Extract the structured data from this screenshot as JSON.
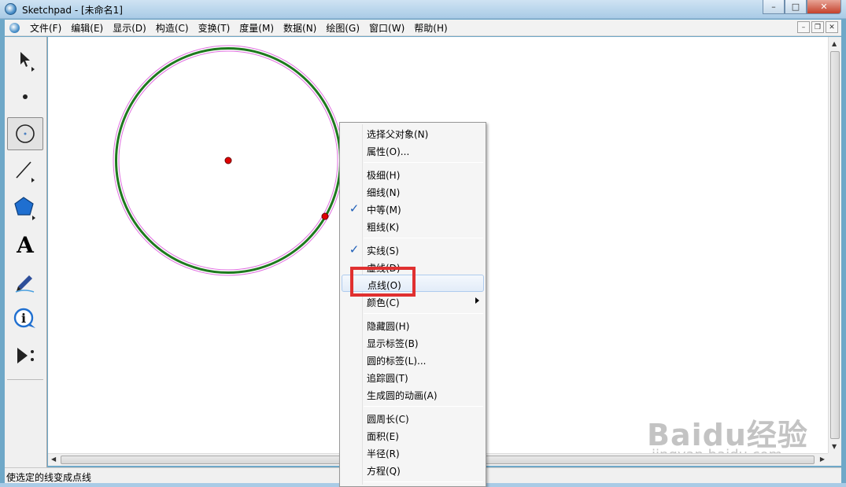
{
  "window": {
    "title": "Sketchpad  - [未命名1]"
  },
  "window_controls": {
    "minimize": "–",
    "maximize": "□",
    "close": "✕"
  },
  "mdi_controls": {
    "minimize": "–",
    "restore": "❐",
    "close": "✕"
  },
  "menubar": {
    "items": [
      "文件(F)",
      "编辑(E)",
      "显示(D)",
      "构造(C)",
      "变换(T)",
      "度量(M)",
      "数据(N)",
      "绘图(G)",
      "窗口(W)",
      "帮助(H)"
    ]
  },
  "toolbox": {
    "tools": [
      {
        "name": "arrow-tool",
        "icon": "arrow-icon"
      },
      {
        "name": "point-tool",
        "icon": "point-icon"
      },
      {
        "name": "compass-tool",
        "icon": "compass-icon",
        "active": true
      },
      {
        "name": "straightedge-tool",
        "icon": "line-icon"
      },
      {
        "name": "polygon-tool",
        "icon": "polygon-icon"
      },
      {
        "name": "text-tool",
        "icon": "text-icon",
        "glyph": "A"
      },
      {
        "name": "marker-tool",
        "icon": "marker-icon"
      },
      {
        "name": "information-tool",
        "icon": "info-icon"
      },
      {
        "name": "custom-tool",
        "icon": "play-icon"
      }
    ]
  },
  "canvas": {
    "circle": {
      "stroke": "#1e7a1e",
      "selection": "#e070e0"
    },
    "points_color": "#e00000"
  },
  "context_menu": {
    "groups": [
      [
        {
          "label": "选择父对象(N)"
        },
        {
          "label": "属性(O)..."
        }
      ],
      [
        {
          "label": "极细(H)"
        },
        {
          "label": "细线(N)"
        },
        {
          "label": "中等(M)",
          "checked": true
        },
        {
          "label": "粗线(K)"
        }
      ],
      [
        {
          "label": "实线(S)",
          "checked": true
        },
        {
          "label": "虚线(D)"
        },
        {
          "label": "点线(O)",
          "hover": true
        },
        {
          "label": "颜色(C)",
          "submenu": true
        }
      ],
      [
        {
          "label": "隐藏圆(H)"
        },
        {
          "label": "显示标签(B)"
        },
        {
          "label": "圆的标签(L)..."
        },
        {
          "label": "追踪圆(T)"
        },
        {
          "label": "生成圆的动画(A)"
        }
      ],
      [
        {
          "label": "圆周长(C)"
        },
        {
          "label": "面积(E)"
        },
        {
          "label": "半径(R)"
        },
        {
          "label": "方程(Q)"
        }
      ]
    ],
    "check_glyph": "✓",
    "highlight_color": "#e03030"
  },
  "statusbar": {
    "text": "使选定的线变成点线"
  },
  "watermark": {
    "brand": "Baidu经验",
    "url": "jingyan.baidu.com"
  }
}
